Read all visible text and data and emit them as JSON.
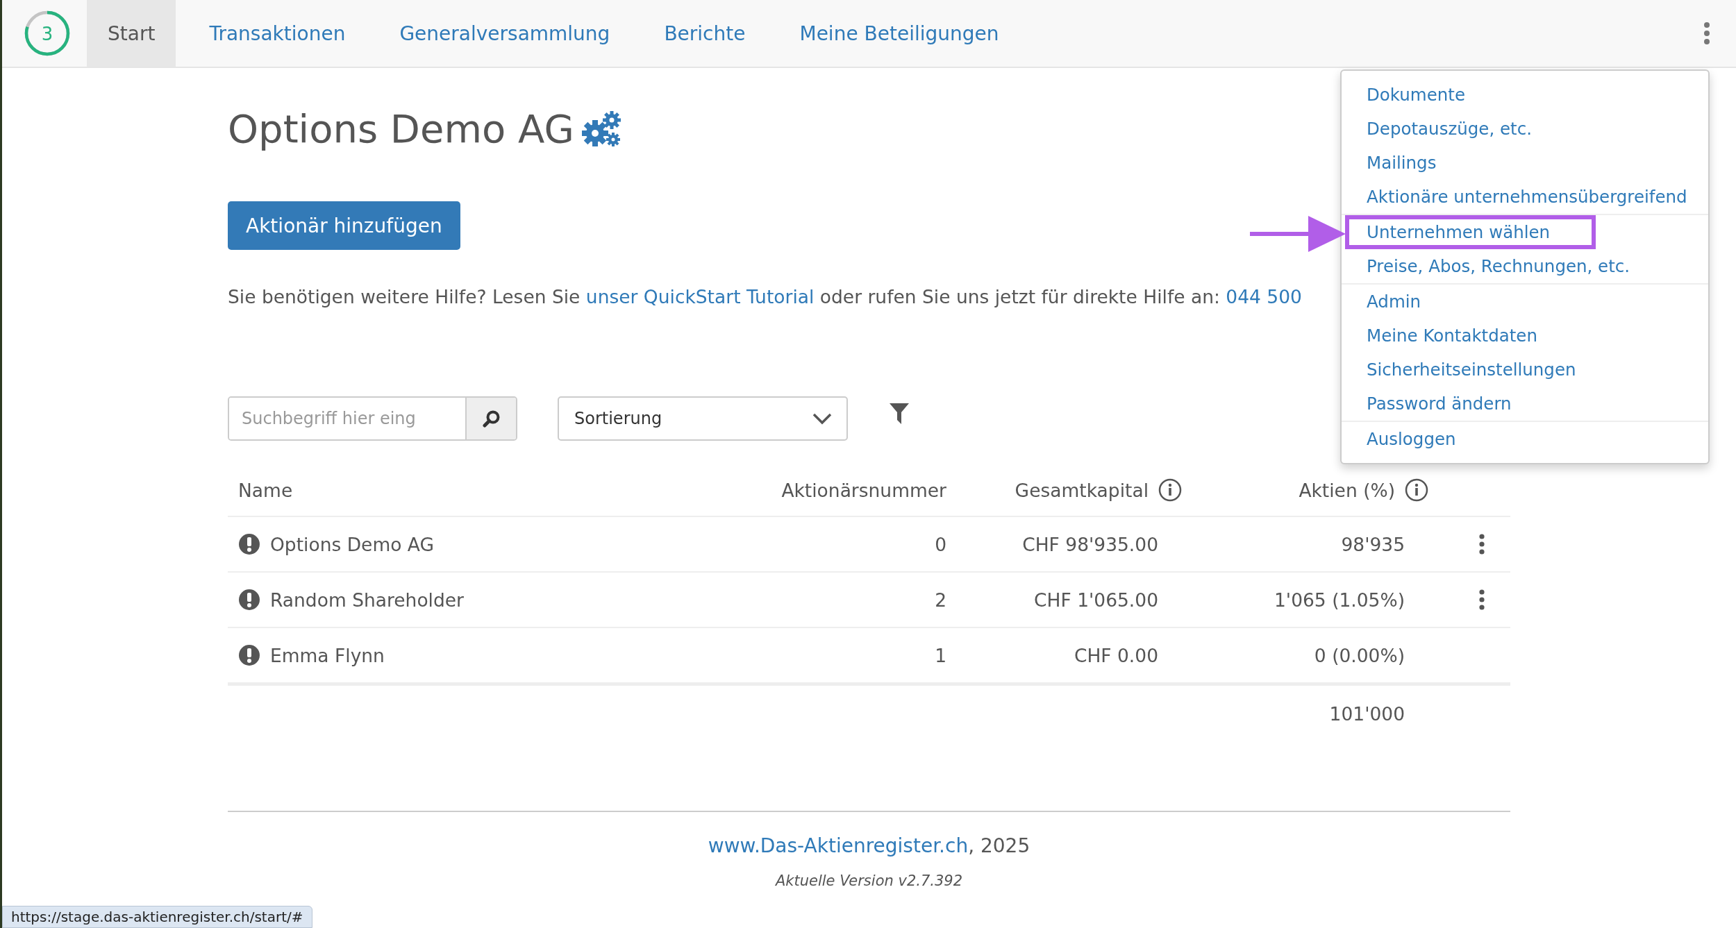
{
  "nav": {
    "badge": "3",
    "level": 0.8,
    "tabs": [
      {
        "label": "Start",
        "selected": true
      },
      {
        "label": "Transaktionen",
        "selected": false
      },
      {
        "label": "Generalversammlung",
        "selected": false
      },
      {
        "label": "Berichte",
        "selected": false
      },
      {
        "label": "Meine Beteiligungen",
        "selected": false
      }
    ]
  },
  "menu": {
    "groups": [
      {
        "items": [
          {
            "label": "Dokumente",
            "highlighted": false
          },
          {
            "label": "Depotauszüge, etc.",
            "highlighted": false
          },
          {
            "label": "Mailings",
            "highlighted": false
          },
          {
            "label": "Aktionäre unternehmensübergreifend",
            "highlighted": false
          }
        ]
      },
      {
        "items": [
          {
            "label": "Unternehmen wählen",
            "highlighted": true
          },
          {
            "label": "Preise, Abos, Rechnungen, etc.",
            "highlighted": false
          }
        ]
      },
      {
        "items": [
          {
            "label": "Admin",
            "highlighted": false
          },
          {
            "label": "Meine Kontaktdaten",
            "highlighted": false
          },
          {
            "label": "Sicherheitseinstellungen",
            "highlighted": false
          },
          {
            "label": "Password ändern",
            "highlighted": false
          }
        ]
      },
      {
        "items": [
          {
            "label": "Ausloggen",
            "highlighted": false
          }
        ]
      }
    ]
  },
  "title": "Options Demo AG",
  "add_button": "Aktionär hinzufügen",
  "help": {
    "before": "Sie benötigen weitere Hilfe? Lesen Sie ",
    "link": "unser QuickStart Tutorial",
    "middle": " oder rufen Sie uns jetzt für direkte Hilfe an: ",
    "phone": "044 500"
  },
  "search": {
    "placeholder": "Suchbegriff hier eing"
  },
  "sort": {
    "value": "Sortierung"
  },
  "table": {
    "columns": [
      {
        "label": "Name",
        "info": false
      },
      {
        "label": "Aktionärsnummer",
        "info": false
      },
      {
        "label": "Gesamtkapital",
        "info": true
      },
      {
        "label": "Aktien (%)",
        "info": true
      }
    ],
    "rows": [
      {
        "name": "Options Demo AG",
        "warning": true,
        "number": "0",
        "capital": "CHF 98'935.00",
        "shares": "98'935",
        "has_menu": true
      },
      {
        "name": "Random Shareholder",
        "warning": true,
        "number": "2",
        "capital": "CHF 1'065.00",
        "shares": "1'065 (1.05%)",
        "has_menu": true
      },
      {
        "name": "Emma Flynn",
        "warning": true,
        "number": "1",
        "capital": "CHF 0.00",
        "shares": "0 (0.00%)",
        "has_menu": false
      }
    ],
    "total": "101'000"
  },
  "footer": {
    "link": "www.Das-Aktienregister.ch",
    "year": ", 2025",
    "version": "Aktuelle Version v2.7.392"
  },
  "status_url": "https://stage.das-aktienregister.ch/start/#"
}
